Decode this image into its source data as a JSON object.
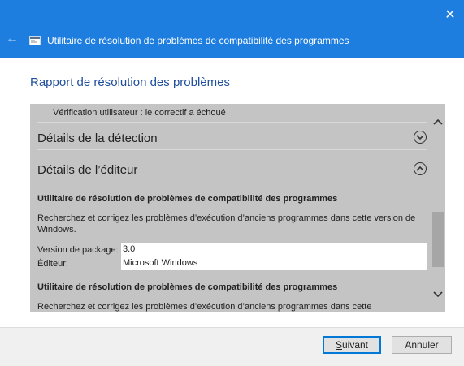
{
  "window": {
    "title": "Utilitaire de résolution de problèmes de compatibilité des programmes",
    "close_icon": "close-icon",
    "back_icon": "back-arrow-icon"
  },
  "report": {
    "heading": "Rapport de résolution des problèmes",
    "user_check": "Vérification utilisateur : le correctif a échoué",
    "sections": {
      "detection": {
        "label": "Détails de la détection",
        "state": "collapsed"
      },
      "publisher": {
        "label": "Détails de l’éditeur",
        "state": "expanded"
      }
    },
    "publisher_entries": [
      {
        "name": "Utilitaire de résolution de problèmes de compatibilité des programmes",
        "description": "Recherchez et corrigez les problèmes d’exécution d’anciens programmes dans cette version de Windows.",
        "fields": [
          {
            "label": "Version de package:",
            "value": "3.0"
          },
          {
            "label": "Éditeur:",
            "value": "Microsoft Windows"
          }
        ]
      },
      {
        "name": "Utilitaire de résolution de problèmes de compatibilité des programmes",
        "description": "Recherchez et corrigez les problèmes d’exécution d’anciens programmes dans cette"
      }
    ]
  },
  "buttons": {
    "next_mnemonic": "S",
    "next_rest": "uivant",
    "cancel": "Annuler"
  },
  "colors": {
    "titlebar": "#1e7ee0",
    "heading": "#1f4e9c",
    "pane": "#c4c4c4"
  }
}
